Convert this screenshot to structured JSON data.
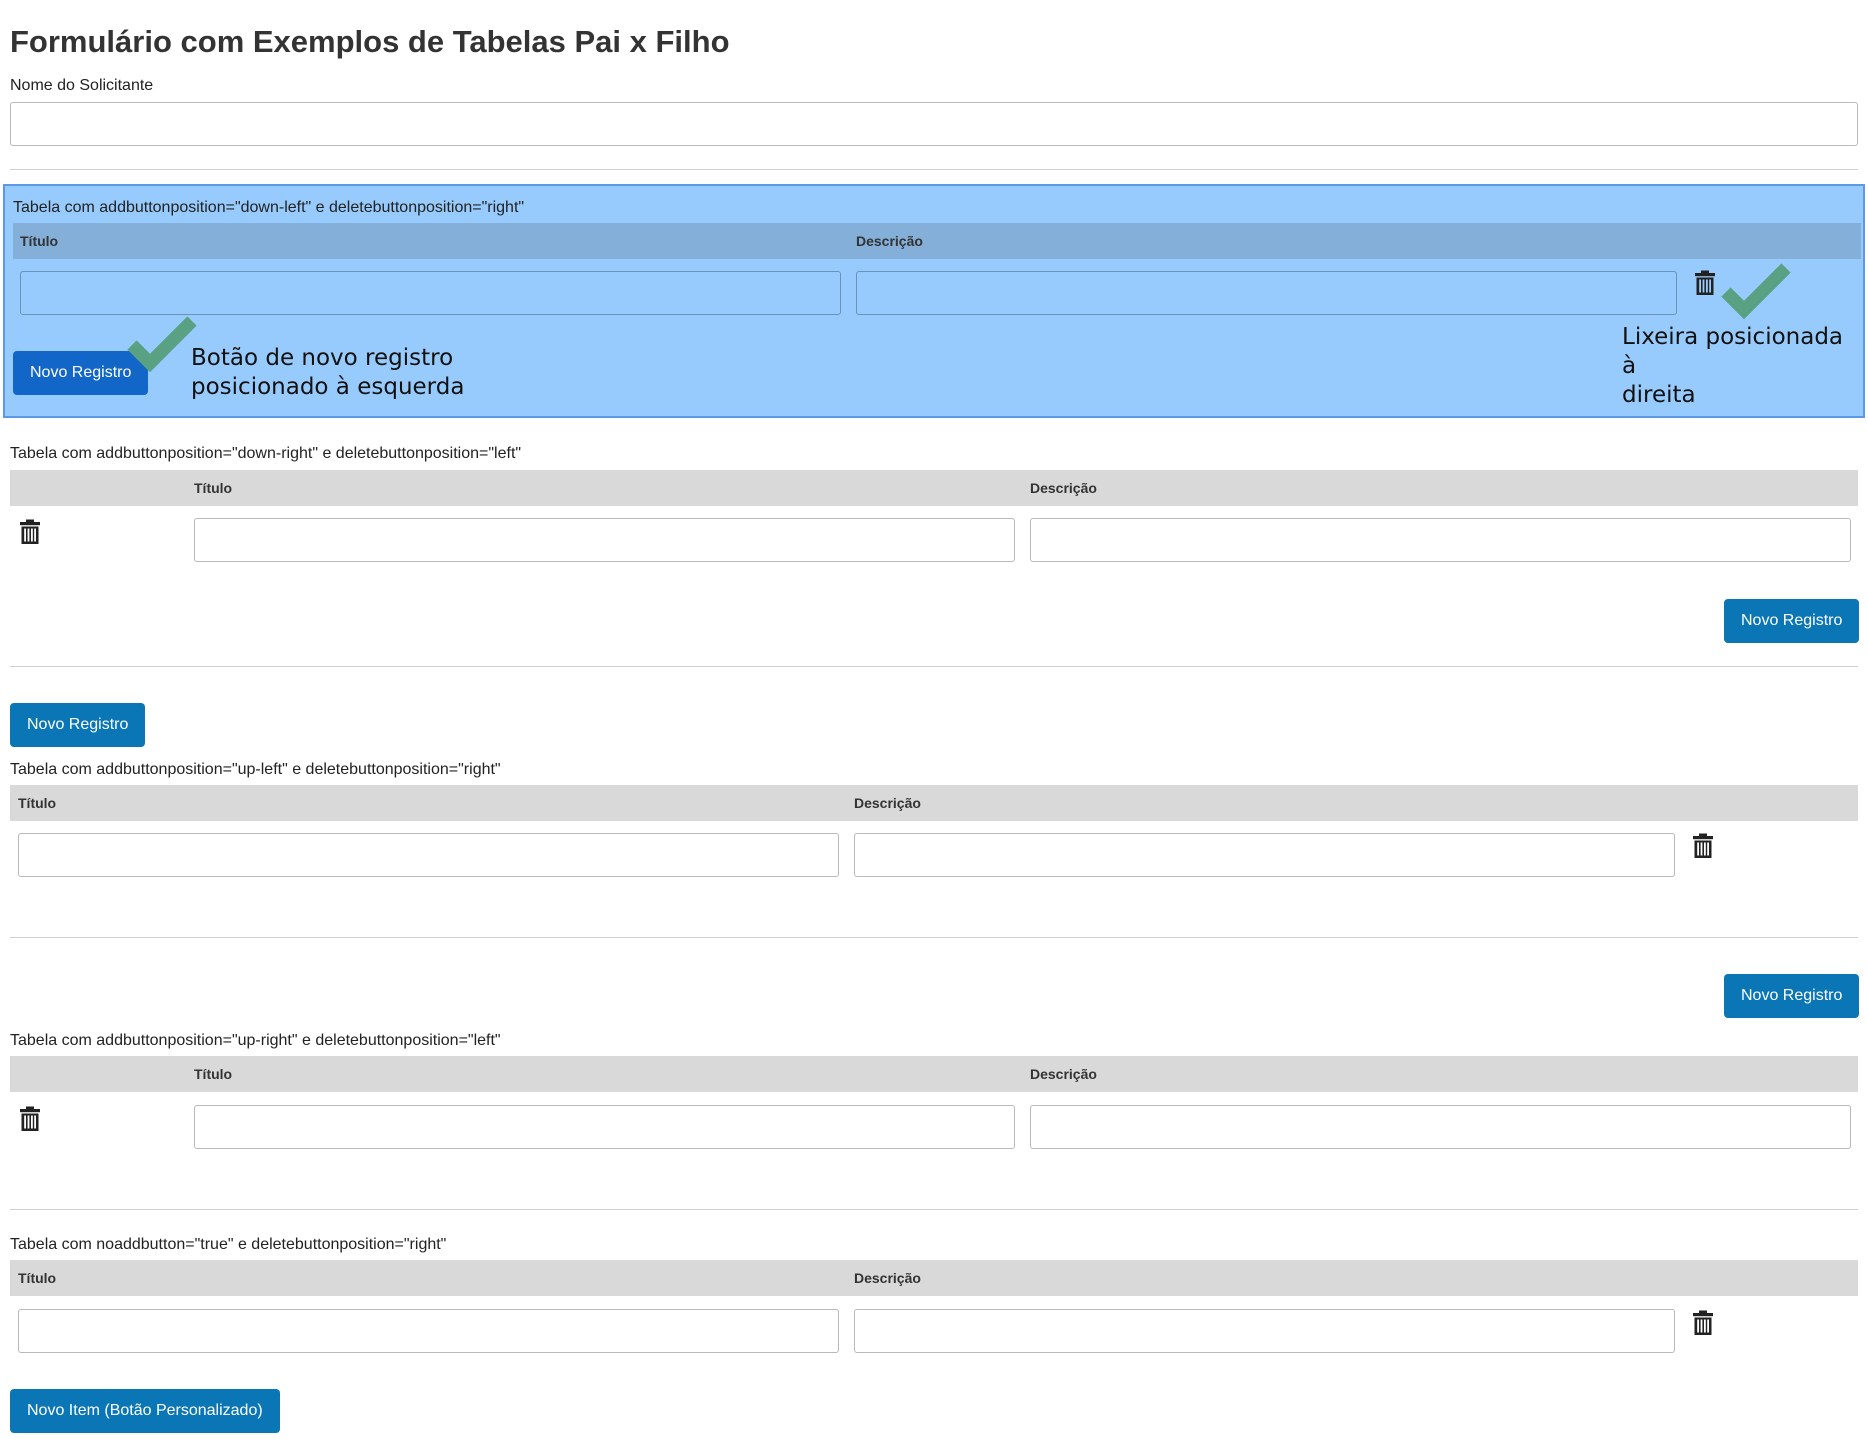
{
  "page": {
    "title": "Formulário com Exemplos de Tabelas Pai x Filho"
  },
  "requester": {
    "label": "Nome do Solicitante",
    "value": ""
  },
  "tables": [
    {
      "caption": "Tabela com addbuttonposition=\"down-left\" e deletebuttonposition=\"right\"",
      "columns": [
        "Título",
        "Descrição"
      ],
      "rows": [
        {
          "titulo": "",
          "descricao": ""
        }
      ],
      "add_button": "Novo Registro"
    },
    {
      "caption": "Tabela com addbuttonposition=\"down-right\" e deletebuttonposition=\"left\"",
      "columns": [
        "Título",
        "Descrição"
      ],
      "rows": [
        {
          "titulo": "",
          "descricao": ""
        }
      ],
      "add_button": "Novo Registro"
    },
    {
      "caption": "Tabela com addbuttonposition=\"up-left\" e deletebuttonposition=\"right\"",
      "columns": [
        "Título",
        "Descrição"
      ],
      "rows": [
        {
          "titulo": "",
          "descricao": ""
        }
      ],
      "add_button": "Novo Registro"
    },
    {
      "caption": "Tabela com addbuttonposition=\"up-right\" e deletebuttonposition=\"left\"",
      "columns": [
        "Título",
        "Descrição"
      ],
      "rows": [
        {
          "titulo": "",
          "descricao": ""
        }
      ],
      "add_button": "Novo Registro"
    },
    {
      "caption": "Tabela com noaddbutton=\"true\" e deletebuttonposition=\"right\"",
      "columns": [
        "Título",
        "Descrição"
      ],
      "rows": [
        {
          "titulo": "",
          "descricao": ""
        }
      ],
      "custom_button": "Novo Item (Botão Personalizado)"
    }
  ],
  "annotations": {
    "add_button_note": [
      "Botão de novo registro",
      "posicionado à esquerda"
    ],
    "trash_note": [
      "Lixeira posicionada à",
      "direita"
    ]
  },
  "icons": {
    "delete": "trash-icon",
    "annotation_mark": "checkmark-icon"
  },
  "colors": {
    "button": "#0a76b5",
    "highlight_background": "#98cbfd",
    "highlight_border": "#5b98e6",
    "table_header": "#d9d9d9",
    "checkmark": "#5aa082"
  }
}
